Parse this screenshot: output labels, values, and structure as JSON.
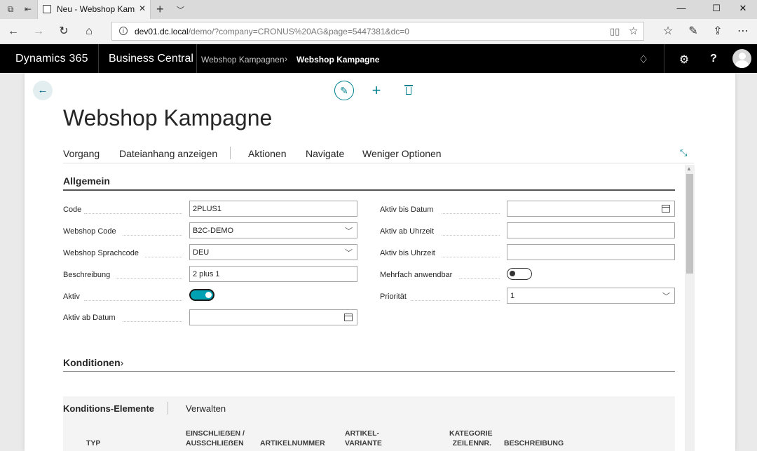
{
  "browser": {
    "tab_title": "Neu - Webshop Kampagne",
    "address_host": "dev01.dc.local",
    "address_path": "/demo/?company=CRONUS%20AG&page=5447381&dc=0"
  },
  "app": {
    "brand": "Dynamics 365",
    "product": "Business Central",
    "breadcrumb_parent": "Webshop Kampagnen",
    "breadcrumb_current": "Webshop Kampagne"
  },
  "page": {
    "title": "Webshop Kampagne",
    "menu": [
      "Vorgang",
      "Dateianhang anzeigen",
      "Aktionen",
      "Navigate",
      "Weniger Optionen"
    ]
  },
  "general": {
    "title": "Allgemein",
    "code_label": "Code",
    "code_value": "2PLUS1",
    "webshop_code_label": "Webshop Code",
    "webshop_code_value": "B2C-DEMO",
    "sprachcode_label": "Webshop Sprachcode",
    "sprachcode_value": "DEU",
    "beschreibung_label": "Beschreibung",
    "beschreibung_value": "2 plus 1",
    "aktiv_label": "Aktiv",
    "aktiv_value": true,
    "aktiv_ab_datum_label": "Aktiv ab Datum",
    "aktiv_ab_datum_value": "",
    "aktiv_bis_datum_label": "Aktiv bis Datum",
    "aktiv_bis_datum_value": "",
    "aktiv_ab_uhrzeit_label": "Aktiv ab Uhrzeit",
    "aktiv_ab_uhrzeit_value": "",
    "aktiv_bis_uhrzeit_label": "Aktiv bis Uhrzeit",
    "aktiv_bis_uhrzeit_value": "",
    "mehrfach_label": "Mehrfach anwendbar",
    "mehrfach_value": false,
    "prioritaet_label": "Priorität",
    "prioritaet_value": "1"
  },
  "conditions": {
    "title": "Konditionen",
    "chevron": "›"
  },
  "subpage": {
    "title": "Konditions-Elemente",
    "manage": "Verwalten",
    "columns": {
      "typ": "TYP",
      "einschl_1": "EINSCHLIEẞEN /",
      "einschl_2": "AUSSCHLIEẞEN",
      "artikelnummer": "ARTIKELNUMMER",
      "variante_1": "ARTIKEL-",
      "variante_2": "VARIANTE",
      "kategorie_1": "KATEGORIE",
      "kategorie_2": "ZEILENNR.",
      "beschreibung": "BESCHREIBUNG"
    }
  },
  "colors": {
    "accent": "#00818f",
    "toggle_on": "#00a1b3",
    "header_bg": "#000000"
  }
}
